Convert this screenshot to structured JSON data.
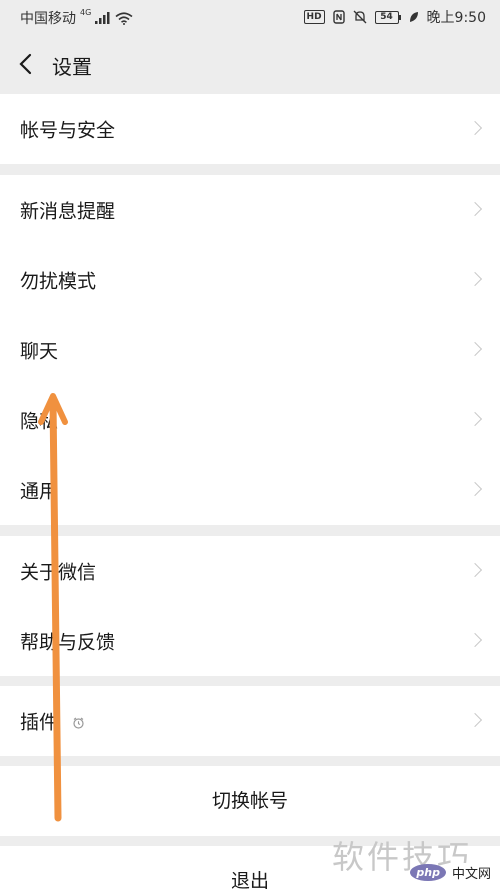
{
  "status_bar": {
    "carrier": "中国移动",
    "network": "4G",
    "hd": "HD",
    "battery": "54",
    "time": "晚上9:50"
  },
  "header": {
    "title": "设置"
  },
  "groups": [
    {
      "items": [
        {
          "label": "帐号与安全"
        }
      ]
    },
    {
      "items": [
        {
          "label": "新消息提醒"
        },
        {
          "label": "勿扰模式"
        },
        {
          "label": "聊天"
        },
        {
          "label": "隐私"
        },
        {
          "label": "通用"
        }
      ]
    },
    {
      "items": [
        {
          "label": "关于微信"
        },
        {
          "label": "帮助与反馈"
        }
      ]
    },
    {
      "items": [
        {
          "label": "插件"
        }
      ]
    }
  ],
  "buttons": {
    "switch_account": "切换帐号",
    "logout": "退出"
  },
  "overlay": {
    "watermark": "软件技巧",
    "logo_php": "php",
    "logo_text": "中文网"
  },
  "colors": {
    "background": "#ededed",
    "arrow": "#f0913f"
  }
}
